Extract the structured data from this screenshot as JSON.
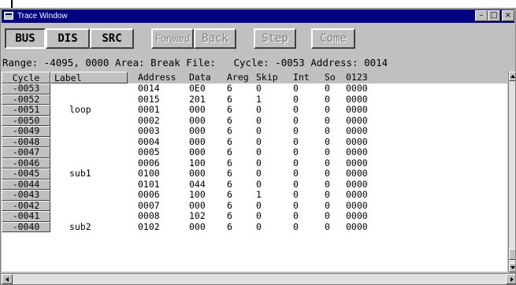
{
  "window": {
    "title": "Trace Window",
    "minimize_glyph": "–",
    "maximize_glyph": "□",
    "close_glyph": "×"
  },
  "toolbar": {
    "bus": "BUS",
    "dis": "DIS",
    "src": "SRC",
    "forward": "Forward",
    "back": "Back",
    "step": "Step",
    "come": "Come",
    "active_tab": "BUS"
  },
  "info": {
    "text": "Range: -4095, 0000 Area: Break File:   Cycle: -0053 Address: 0014"
  },
  "table": {
    "headers": {
      "cycle": "Cycle",
      "label": "Label",
      "address": "Address",
      "data": "Data",
      "areg": "Areg",
      "skip": "Skip",
      "int": "Int",
      "so": "So",
      "bits": "0123"
    },
    "rows": [
      {
        "cycle": "-0053",
        "label": "",
        "address": "0014",
        "data": "0E0",
        "areg": "6",
        "skip": "0",
        "int": "0",
        "so": "0",
        "bits": "0000"
      },
      {
        "cycle": "-0052",
        "label": "",
        "address": "0015",
        "data": "201",
        "areg": "6",
        "skip": "1",
        "int": "0",
        "so": "0",
        "bits": "0000"
      },
      {
        "cycle": "-0051",
        "label": "loop",
        "address": "0001",
        "data": "000",
        "areg": "6",
        "skip": "0",
        "int": "0",
        "so": "0",
        "bits": "0000"
      },
      {
        "cycle": "-0050",
        "label": "",
        "address": "0002",
        "data": "000",
        "areg": "6",
        "skip": "0",
        "int": "0",
        "so": "0",
        "bits": "0000"
      },
      {
        "cycle": "-0049",
        "label": "",
        "address": "0003",
        "data": "000",
        "areg": "6",
        "skip": "0",
        "int": "0",
        "so": "0",
        "bits": "0000"
      },
      {
        "cycle": "-0048",
        "label": "",
        "address": "0004",
        "data": "000",
        "areg": "6",
        "skip": "0",
        "int": "0",
        "so": "0",
        "bits": "0000"
      },
      {
        "cycle": "-0047",
        "label": "",
        "address": "0005",
        "data": "000",
        "areg": "6",
        "skip": "0",
        "int": "0",
        "so": "0",
        "bits": "0000"
      },
      {
        "cycle": "-0046",
        "label": "",
        "address": "0006",
        "data": "100",
        "areg": "6",
        "skip": "0",
        "int": "0",
        "so": "0",
        "bits": "0000"
      },
      {
        "cycle": "-0045",
        "label": "sub1",
        "address": "0100",
        "data": "000",
        "areg": "6",
        "skip": "0",
        "int": "0",
        "so": "0",
        "bits": "0000"
      },
      {
        "cycle": "-0044",
        "label": "",
        "address": "0101",
        "data": "044",
        "areg": "6",
        "skip": "0",
        "int": "0",
        "so": "0",
        "bits": "0000"
      },
      {
        "cycle": "-0043",
        "label": "",
        "address": "0006",
        "data": "100",
        "areg": "6",
        "skip": "1",
        "int": "0",
        "so": "0",
        "bits": "0000"
      },
      {
        "cycle": "-0042",
        "label": "",
        "address": "0007",
        "data": "000",
        "areg": "6",
        "skip": "0",
        "int": "0",
        "so": "0",
        "bits": "0000"
      },
      {
        "cycle": "-0041",
        "label": "",
        "address": "0008",
        "data": "102",
        "areg": "6",
        "skip": "0",
        "int": "0",
        "so": "0",
        "bits": "0000"
      },
      {
        "cycle": "-0040",
        "label": "sub2",
        "address": "0102",
        "data": "000",
        "areg": "6",
        "skip": "0",
        "int": "0",
        "so": "0",
        "bits": "0000"
      }
    ]
  },
  "colors": {
    "titlebar": "#000080",
    "face": "#c0c0c0",
    "content": "#ffffff"
  }
}
